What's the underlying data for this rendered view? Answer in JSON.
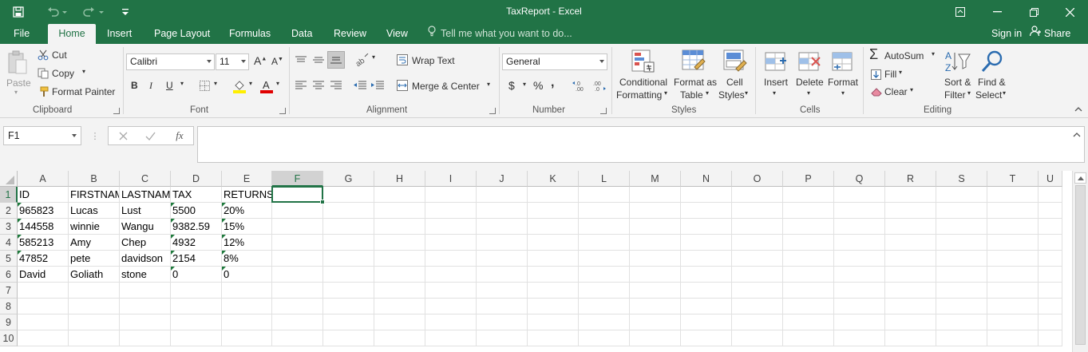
{
  "window": {
    "title": "TaxReport - Excel"
  },
  "menu": {
    "tabs": [
      "File",
      "Home",
      "Insert",
      "Page Layout",
      "Formulas",
      "Data",
      "Review",
      "View"
    ],
    "active": "Home",
    "tell_me": "Tell me what you want to do...",
    "sign_in": "Sign in",
    "share": "Share"
  },
  "ribbon": {
    "clipboard": {
      "paste": "Paste",
      "cut": "Cut",
      "copy": "Copy",
      "format_painter": "Format Painter",
      "label": "Clipboard"
    },
    "font": {
      "name": "Calibri",
      "size": "11",
      "label": "Font"
    },
    "alignment": {
      "wrap_text": "Wrap Text",
      "merge_center": "Merge & Center",
      "label": "Alignment"
    },
    "number": {
      "format": "General",
      "currency": "$",
      "percent": "%",
      "comma": ",",
      "label": "Number"
    },
    "styles": {
      "conditional_1": "Conditional",
      "conditional_2": "Formatting",
      "format_table_1": "Format as",
      "format_table_2": "Table",
      "cell_styles_1": "Cell",
      "cell_styles_2": "Styles",
      "label": "Styles"
    },
    "cells": {
      "insert": "Insert",
      "delete": "Delete",
      "format": "Format",
      "label": "Cells"
    },
    "editing": {
      "autosum": "AutoSum",
      "fill": "Fill",
      "clear": "Clear",
      "sort_1": "Sort &",
      "sort_2": "Filter",
      "find_1": "Find &",
      "find_2": "Select",
      "label": "Editing"
    }
  },
  "formula_bar": {
    "name_box": "F1",
    "fx": "fx",
    "value": ""
  },
  "sheet": {
    "columns": [
      "A",
      "B",
      "C",
      "D",
      "E",
      "F",
      "G",
      "H",
      "I",
      "J",
      "K",
      "L",
      "M",
      "N",
      "O",
      "P",
      "Q",
      "R",
      "S",
      "T",
      "U"
    ],
    "rows": [
      "1",
      "2",
      "3",
      "4",
      "5",
      "6",
      "7",
      "8",
      "9",
      "10"
    ],
    "selected_cell": "F1",
    "data": [
      [
        "ID",
        "FIRSTNAM",
        "LASTNAM",
        "TAX",
        "RETURNS"
      ],
      [
        "965823",
        "Lucas",
        "Lust",
        "5500",
        "20%"
      ],
      [
        "144558",
        "winnie",
        "Wangu",
        "9382.59",
        "15%"
      ],
      [
        "585213",
        "Amy",
        "Chep",
        "4932",
        "12%"
      ],
      [
        "47852",
        "pete",
        "davidson",
        "2154",
        "8%"
      ],
      [
        "David",
        "Goliath",
        "stone",
        "0",
        "0"
      ]
    ]
  },
  "colors": {
    "accent": "#217346",
    "ribbon_bg": "#f3f3f3",
    "error_triangle": "#1e7a3c"
  }
}
